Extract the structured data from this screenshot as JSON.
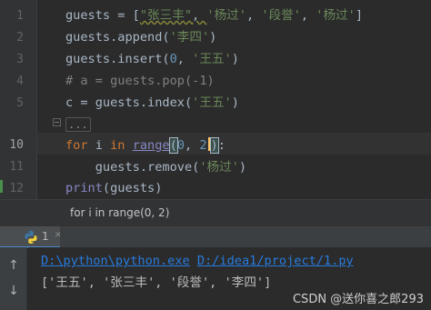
{
  "editor": {
    "line_numbers": [
      "1",
      "2",
      "3",
      "4",
      "5",
      "",
      "10",
      "11",
      "12"
    ],
    "lines": {
      "l1": {
        "var": "guests",
        "op": " = ",
        "open": "[",
        "s1": "\"张三丰\"",
        "c1": ", ",
        "s2": "'杨过'",
        "c2": ", ",
        "s3": "'段誉'",
        "c3": ", ",
        "s4": "'杨过'",
        "close": "]"
      },
      "l2": {
        "pre": "guests.append(",
        "arg": "'李四'",
        "post": ")"
      },
      "l3": {
        "pre": "guests.insert(",
        "num": "0",
        "mid": ", ",
        "arg": "'王五'",
        "post": ")"
      },
      "l4": {
        "comment": "# a = guests.pop(-1)"
      },
      "l5": {
        "pre": "c = guests.index(",
        "arg": "'王五'",
        "post": ")"
      },
      "l6": {
        "folded": "..."
      },
      "l10": {
        "kw1": "for",
        "v": " i ",
        "kw2": "in",
        "sp": " ",
        "fn": "range",
        "open": "(",
        "n1": "0",
        "comma": ", ",
        "n2": "2",
        "close": ")",
        "colon": ":"
      },
      "l11": {
        "indent": "    ",
        "pre": "guests.remove(",
        "arg": "'杨过'",
        "post": ")"
      },
      "l12": {
        "fn": "print",
        "rest": "(guests)"
      }
    }
  },
  "breadcrumb": {
    "text": "for i in range(0, 2)"
  },
  "run_panel": {
    "tab_label": "1",
    "tab_icon": "python-icon",
    "up_icon": "↑",
    "down_icon": "↓",
    "console": {
      "cmd_exe": "D:\\python\\python.exe",
      "cmd_space": " ",
      "cmd_script": "D:/idea1/project/1.py",
      "output": "['王五', '张三丰', '段誉', '李四']"
    }
  },
  "watermark": "CSDN @送你喜之郎293",
  "colors": {
    "background": "#2b2b2b",
    "keyword": "#cc7832",
    "string": "#6a8759",
    "number": "#6897bb",
    "builtin": "#8888c6",
    "comment": "#808080",
    "link": "#287bde"
  }
}
